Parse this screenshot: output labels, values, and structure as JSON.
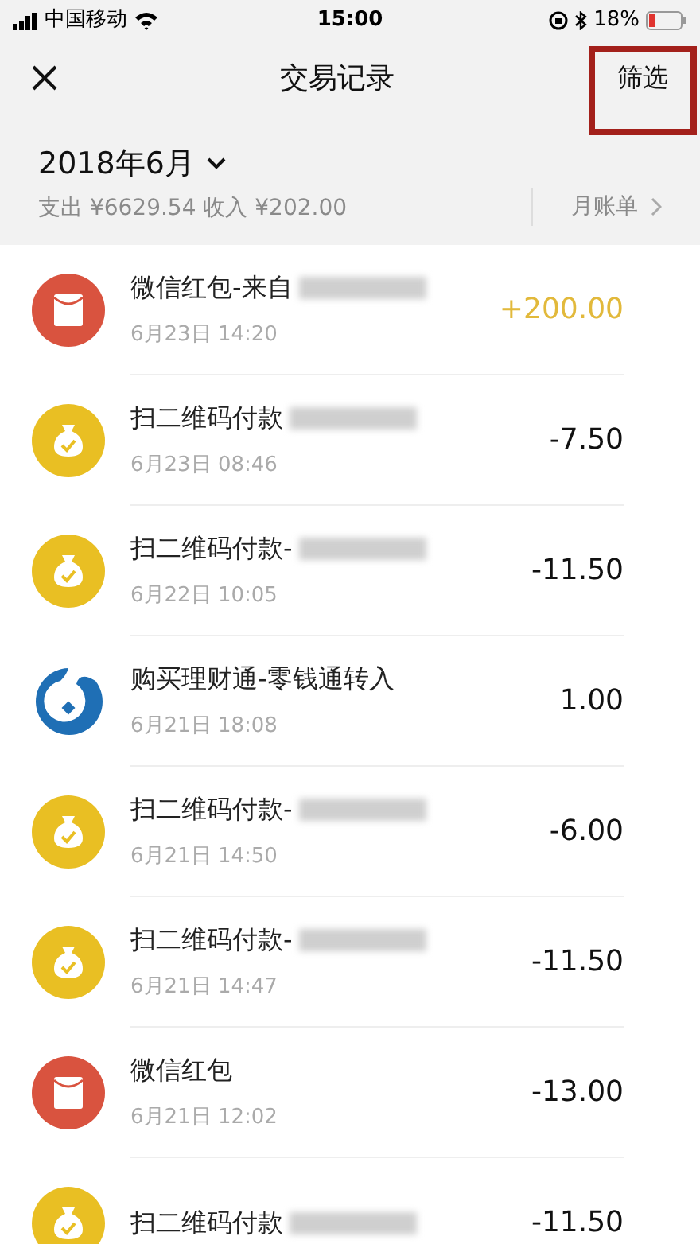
{
  "status_bar": {
    "carrier": "中国移动",
    "time": "15:00",
    "battery": "18%"
  },
  "nav": {
    "title": "交易记录",
    "filter": {
      "label": "筛选",
      "highlighted": true
    }
  },
  "summary": {
    "month": "2018年6月",
    "totals": "支出 ¥6629.54 收入 ¥202.00",
    "monthly_bill": "月账单"
  },
  "transactions": [
    {
      "kind": "red_packet",
      "title": "微信红包-来自",
      "redacted": true,
      "date": "6月23日 14:20",
      "amount": "+200.00",
      "income": true
    },
    {
      "kind": "money_bag",
      "title": "扫二维码付款",
      "redacted": true,
      "date": "6月23日 08:46",
      "amount": "-7.50",
      "income": false
    },
    {
      "kind": "money_bag",
      "title": "扫二维码付款-",
      "redacted": true,
      "date": "6月22日 10:05",
      "amount": "-11.50",
      "income": false
    },
    {
      "kind": "licaitong",
      "title": "购买理财通-零钱通转入",
      "redacted": false,
      "date": "6月21日 18:08",
      "amount": "1.00",
      "income": false
    },
    {
      "kind": "money_bag",
      "title": "扫二维码付款-",
      "redacted": true,
      "date": "6月21日 14:50",
      "amount": "-6.00",
      "income": false
    },
    {
      "kind": "money_bag",
      "title": "扫二维码付款-",
      "redacted": true,
      "date": "6月21日 14:47",
      "amount": "-11.50",
      "income": false
    },
    {
      "kind": "red_packet",
      "title": "微信红包",
      "redacted": false,
      "date": "6月21日 12:02",
      "amount": "-13.00",
      "income": false
    },
    {
      "kind": "money_bag",
      "title": "扫二维码付款",
      "redacted": true,
      "amount": "-11.50",
      "income": false
    }
  ]
}
